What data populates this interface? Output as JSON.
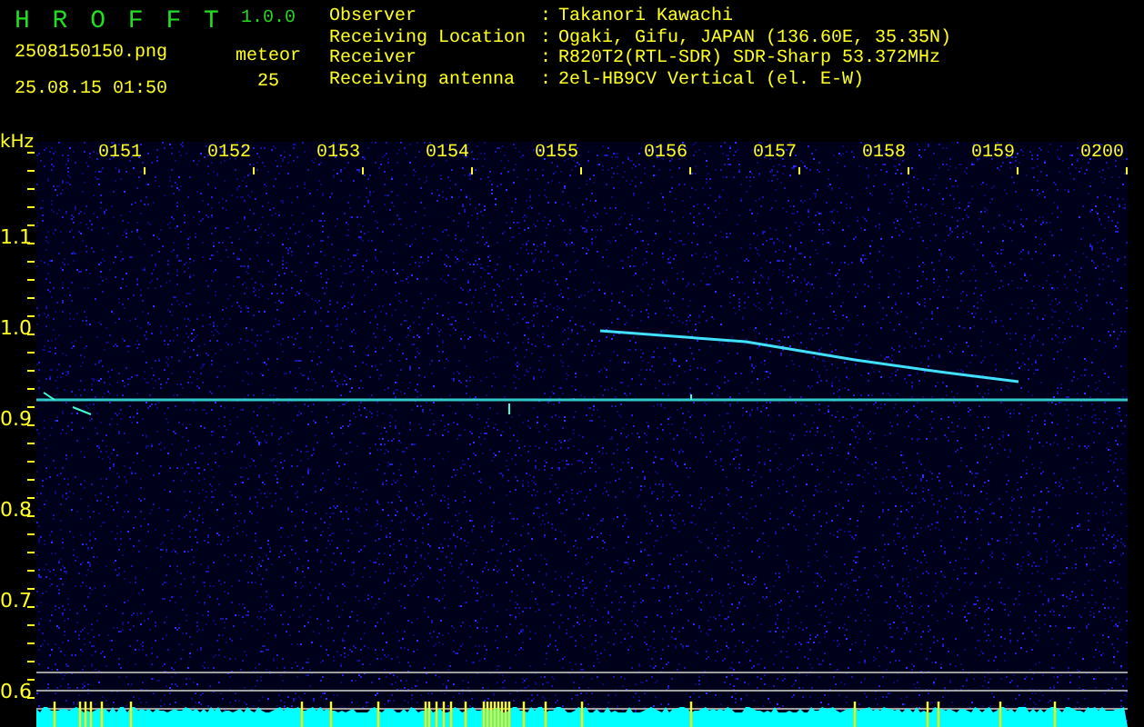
{
  "app": {
    "name": "H R O F F T",
    "version": "1.0.0"
  },
  "file": {
    "name": "2508150150.png",
    "timestamp": "25.08.15 01:50"
  },
  "meteor": {
    "label": "meteor",
    "count": "25"
  },
  "station": [
    {
      "label": "Observer",
      "separator": ":",
      "value": "Takanori Kawachi"
    },
    {
      "label": "Receiving Location",
      "separator": ":",
      "value": "Ogaki, Gifu, JAPAN (136.60E, 35.35N)"
    },
    {
      "label": "Receiver",
      "separator": ":",
      "value": "R820T2(RTL-SDR) SDR-Sharp 53.372MHz"
    },
    {
      "label": "Receiving antenna",
      "separator": ":",
      "value": "2el-HB9CV Vertical (el. E-W)"
    }
  ],
  "y_axis": {
    "unit": "kHz",
    "ticks": [
      "1.1",
      "1.0",
      "0.9",
      "0.8",
      "0.7",
      "0.6"
    ]
  },
  "x_axis": {
    "ticks": [
      "0151",
      "0152",
      "0153",
      "0154",
      "0155",
      "0156",
      "0157",
      "0158",
      "0159",
      "0200"
    ]
  }
}
